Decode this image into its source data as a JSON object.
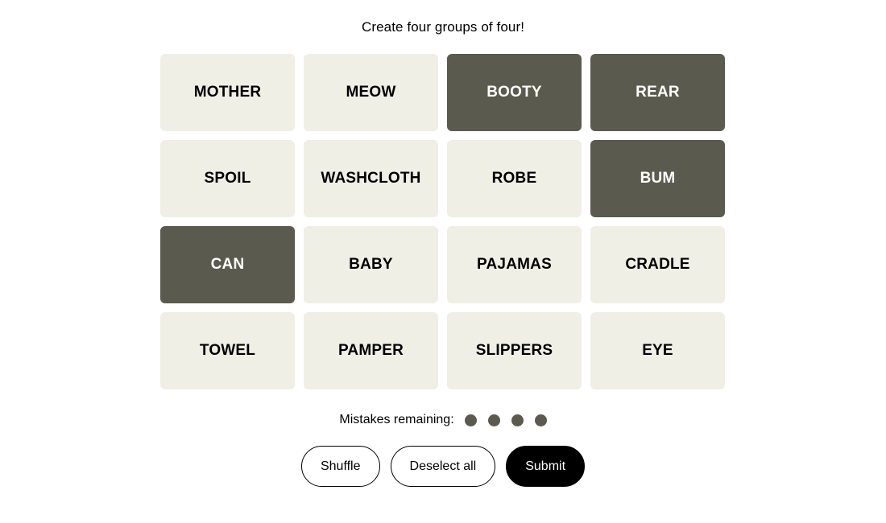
{
  "header": {
    "instruction": "Create four groups of four!"
  },
  "board": {
    "columns": 4,
    "rows": 4,
    "colors": {
      "tile_unselected_bg": "#efefe6",
      "tile_unselected_text": "#000000",
      "tile_selected_bg": "#5a5a4e",
      "tile_selected_text": "#ffffff",
      "page_bg": "#ffffff"
    },
    "tiles": [
      {
        "label": "MOTHER",
        "selected": false
      },
      {
        "label": "MEOW",
        "selected": false
      },
      {
        "label": "BOOTY",
        "selected": true
      },
      {
        "label": "REAR",
        "selected": true
      },
      {
        "label": "SPOIL",
        "selected": false
      },
      {
        "label": "WASHCLOTH",
        "selected": false
      },
      {
        "label": "ROBE",
        "selected": false
      },
      {
        "label": "BUM",
        "selected": true
      },
      {
        "label": "CAN",
        "selected": true
      },
      {
        "label": "BABY",
        "selected": false
      },
      {
        "label": "PAJAMAS",
        "selected": false
      },
      {
        "label": "CRADLE",
        "selected": false
      },
      {
        "label": "TOWEL",
        "selected": false
      },
      {
        "label": "PAMPER",
        "selected": false
      },
      {
        "label": "SLIPPERS",
        "selected": false
      },
      {
        "label": "EYE",
        "selected": false
      }
    ]
  },
  "mistakes": {
    "label": "Mistakes remaining:",
    "remaining": 4,
    "dot_color": "#5a5a4e"
  },
  "controls": {
    "shuffle_label": "Shuffle",
    "deselect_label": "Deselect all",
    "submit_label": "Submit",
    "submit_bg": "#000000",
    "submit_text": "#ffffff"
  }
}
